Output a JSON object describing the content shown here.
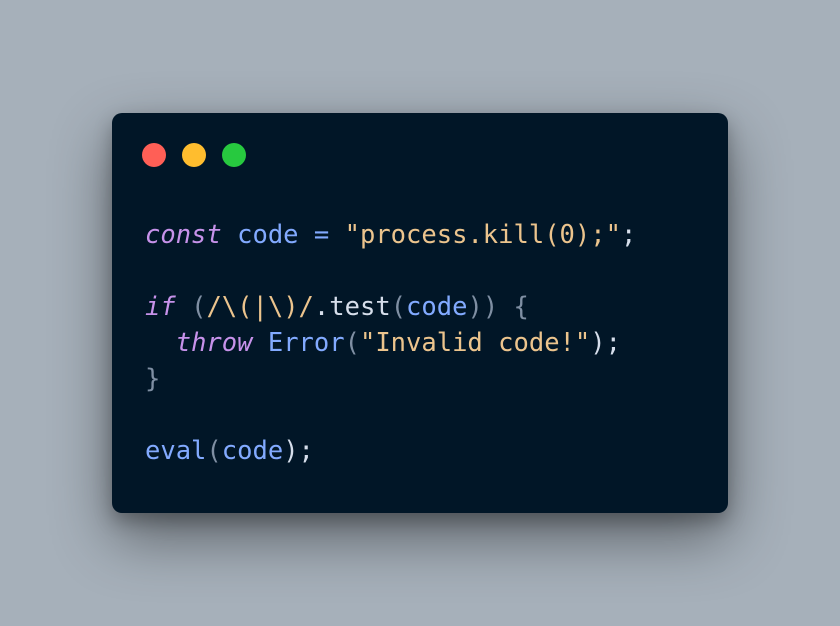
{
  "colors": {
    "background": "#a6b0ba",
    "window": "#011627",
    "dot_close": "#ff5f56",
    "dot_minimize": "#ffbd2e",
    "dot_maximize": "#27c93f",
    "keyword": "#c792ea",
    "identifier": "#82aaff",
    "string": "#ecc48d",
    "punctuation": "#7f8fa3",
    "plain": "#d6deeb"
  },
  "code": {
    "lines": [
      [
        {
          "t": "const",
          "c": "keyword",
          "i": true
        },
        {
          "t": " ",
          "c": "plain"
        },
        {
          "t": "code",
          "c": "identifier"
        },
        {
          "t": " ",
          "c": "plain"
        },
        {
          "t": "=",
          "c": "identifier"
        },
        {
          "t": " ",
          "c": "plain"
        },
        {
          "t": "\"process.kill(0);\"",
          "c": "string"
        },
        {
          "t": ";",
          "c": "plain"
        }
      ],
      [],
      [
        {
          "t": "if",
          "c": "keyword",
          "i": true
        },
        {
          "t": " ",
          "c": "plain"
        },
        {
          "t": "(",
          "c": "punctuation"
        },
        {
          "t": "/\\(|\\)/",
          "c": "string"
        },
        {
          "t": ".",
          "c": "plain"
        },
        {
          "t": "test",
          "c": "plain"
        },
        {
          "t": "(",
          "c": "punctuation"
        },
        {
          "t": "code",
          "c": "identifier"
        },
        {
          "t": "))",
          "c": "punctuation"
        },
        {
          "t": " ",
          "c": "plain"
        },
        {
          "t": "{",
          "c": "punctuation"
        }
      ],
      [
        {
          "t": "  ",
          "c": "plain"
        },
        {
          "t": "throw",
          "c": "keyword",
          "i": true
        },
        {
          "t": " ",
          "c": "plain"
        },
        {
          "t": "Error",
          "c": "identifier"
        },
        {
          "t": "(",
          "c": "punctuation"
        },
        {
          "t": "\"Invalid code!\"",
          "c": "string"
        },
        {
          "t": ");",
          "c": "plain"
        }
      ],
      [
        {
          "t": "}",
          "c": "punctuation"
        }
      ],
      [],
      [
        {
          "t": "eval",
          "c": "identifier"
        },
        {
          "t": "(",
          "c": "punctuation"
        },
        {
          "t": "code",
          "c": "identifier"
        },
        {
          "t": ");",
          "c": "plain"
        }
      ]
    ]
  }
}
